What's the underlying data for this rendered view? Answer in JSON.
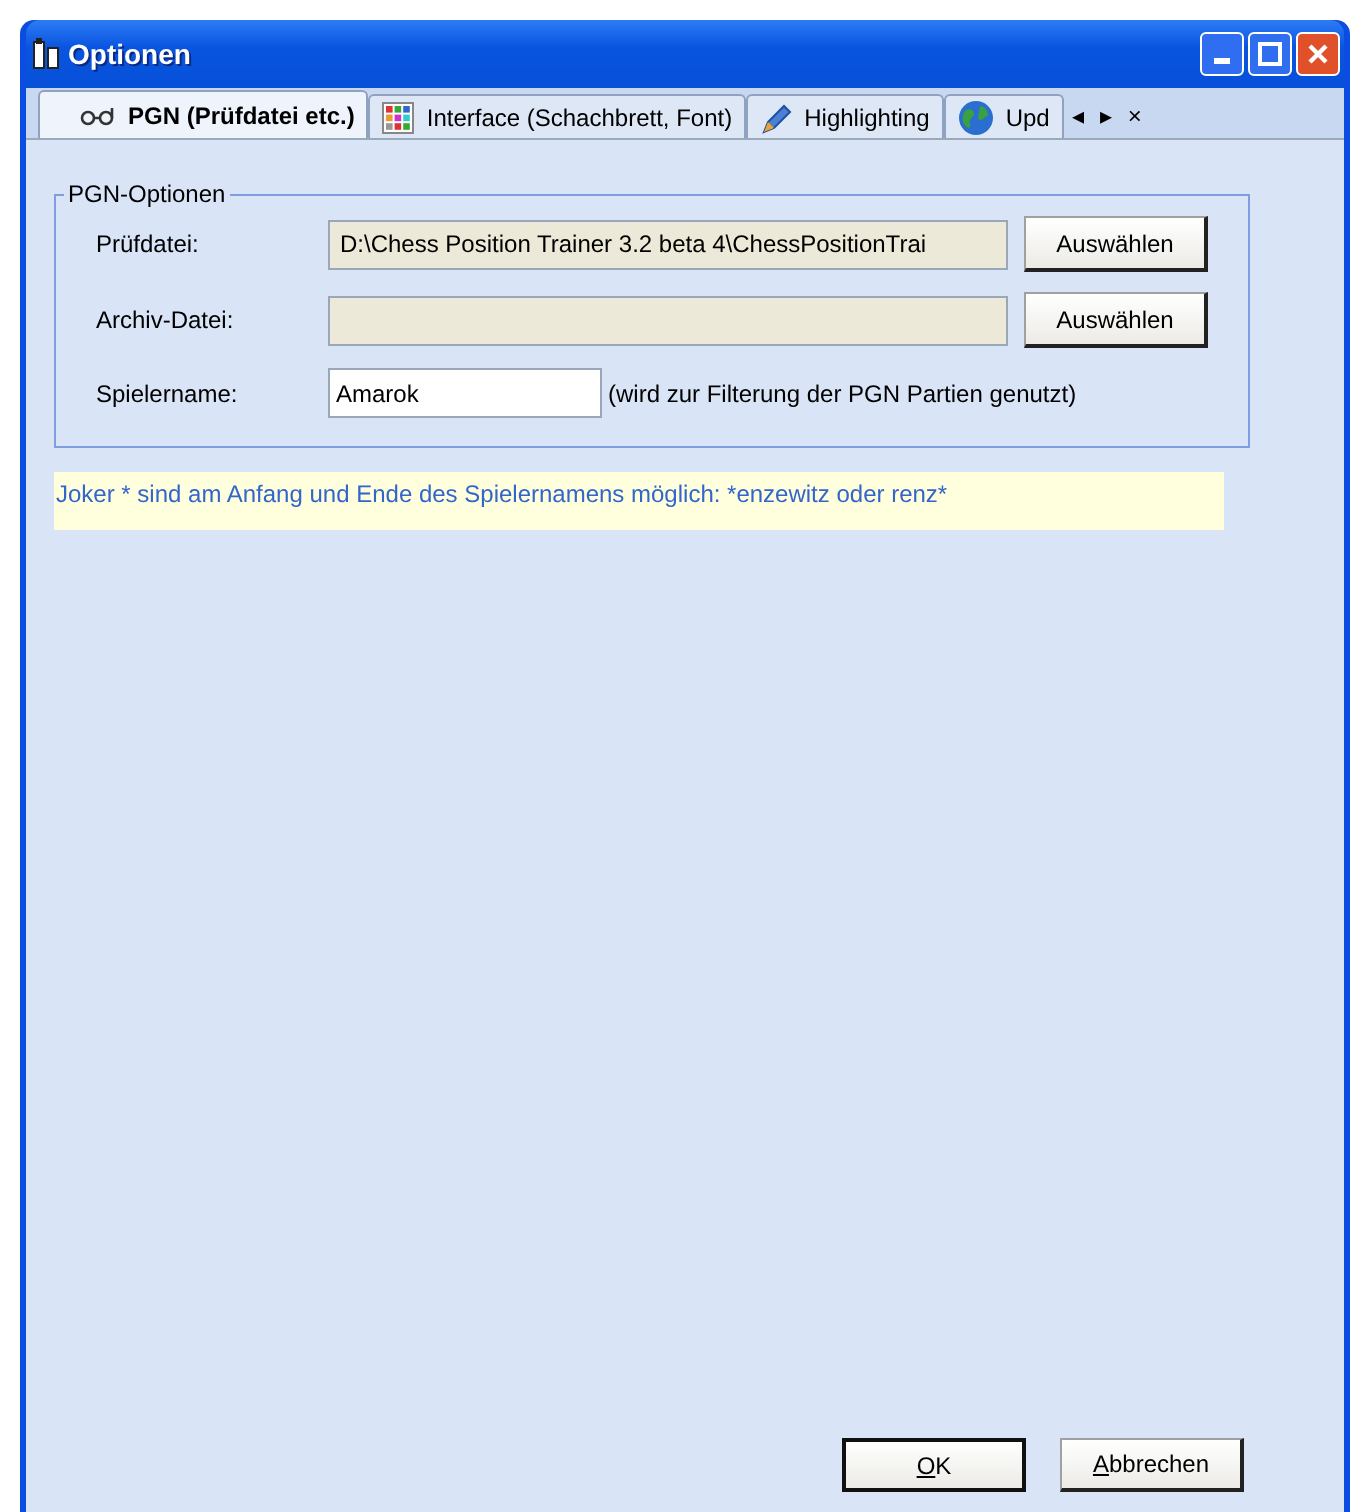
{
  "window": {
    "title": "Optionen"
  },
  "tabs": [
    {
      "label": "PGN (Prüfdatei etc.)",
      "selected": true
    },
    {
      "label": "Interface (Schachbrett, Font)",
      "selected": false
    },
    {
      "label": "Highlighting",
      "selected": false
    },
    {
      "label": "Upd",
      "selected": false
    }
  ],
  "tab_nav": [
    "◂",
    "▸",
    "×"
  ],
  "group": {
    "title": "PGN-Optionen",
    "rows": [
      {
        "kind": "file",
        "label": "Prüfdatei:",
        "value": "D:\\Chess Position Trainer 3.2 beta 4\\ChessPositionTrai",
        "button": "Auswählen"
      },
      {
        "kind": "file",
        "label": "Archiv-Datei:",
        "button": "Auswählen"
      },
      {
        "kind": "text",
        "label": "Spielername:",
        "value": "Amarok",
        "note": "(wird zur Filterung der PGN Partien genutzt)"
      }
    ]
  },
  "hint": "Joker * sind am Anfang und Ende des Spielernamens möglich: *enzewitz oder renz*",
  "buttons": [
    {
      "label": "OK",
      "default": true
    },
    {
      "label": "Abbrechen",
      "default": false
    }
  ]
}
